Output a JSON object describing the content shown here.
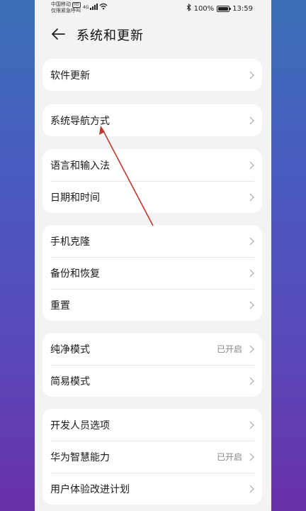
{
  "statusbar": {
    "carrier": "中国移动",
    "hd": "HD",
    "emergency": "仅限紧急呼叫",
    "network": "4G",
    "battery": "100%",
    "time": "13:59"
  },
  "header": {
    "title": "系统和更新"
  },
  "groups": [
    {
      "items": [
        {
          "label": "软件更新",
          "value": ""
        }
      ]
    },
    {
      "items": [
        {
          "label": "系统导航方式",
          "value": ""
        }
      ]
    },
    {
      "items": [
        {
          "label": "语言和输入法",
          "value": ""
        },
        {
          "label": "日期和时间",
          "value": ""
        }
      ]
    },
    {
      "items": [
        {
          "label": "手机克隆",
          "value": ""
        },
        {
          "label": "备份和恢复",
          "value": ""
        },
        {
          "label": "重置",
          "value": ""
        }
      ]
    },
    {
      "items": [
        {
          "label": "纯净模式",
          "value": "已开启"
        },
        {
          "label": "简易模式",
          "value": ""
        }
      ]
    },
    {
      "items": [
        {
          "label": "开发人员选项",
          "value": ""
        },
        {
          "label": "华为智慧能力",
          "value": "已开启"
        },
        {
          "label": "用户体验改进计划",
          "value": ""
        }
      ]
    }
  ],
  "colors": {
    "annotation_arrow": "#c0392b",
    "background_top": "#3b6fb8",
    "background_bottom": "#6a30a8"
  }
}
